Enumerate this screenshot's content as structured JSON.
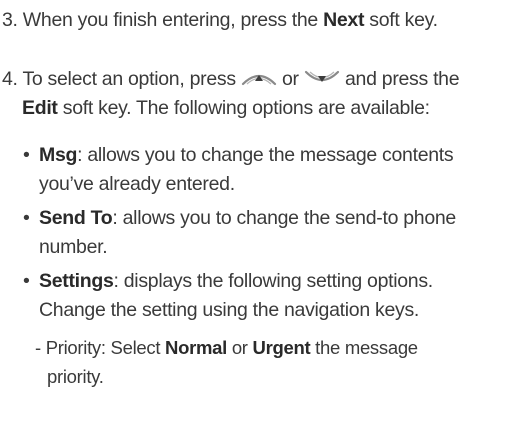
{
  "step3": {
    "num": "3.",
    "text1": "When you finish entering, press the",
    "key": "Next",
    "text2": "soft key."
  },
  "step4": {
    "num": "4.",
    "text1": "To select an option, press",
    "or": "or",
    "text2": "and press the",
    "key": "Edit",
    "text3": "soft key. The following options are available:",
    "icon_up": "nav-up-key-icon",
    "icon_down": "nav-down-key-icon"
  },
  "options": [
    {
      "bullet": "•",
      "name": "Msg",
      "line1": ": allows you to change the message contents",
      "line2": "you’ve already entered."
    },
    {
      "bullet": "•",
      "name": "Send To",
      "line1": ": allows you to change the send-to phone",
      "line2": "number."
    },
    {
      "bullet": "•",
      "name": "Settings",
      "line1": ": displays the following setting options.",
      "line2": "Change the setting using the navigation keys."
    }
  ],
  "sub_option": {
    "prefix": "- Priority: Select",
    "opt1": "Normal",
    "or": "or",
    "opt2": "Urgent",
    "suffix": "the message",
    "line2": "priority."
  }
}
